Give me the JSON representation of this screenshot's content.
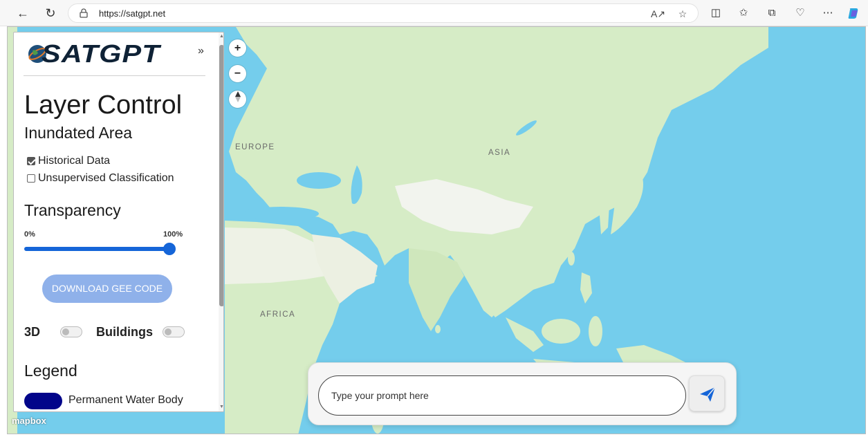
{
  "browser": {
    "url": "https://satgpt.net",
    "icons": [
      "back-icon",
      "refresh-icon",
      "lock-icon",
      "read-aloud-icon",
      "favorite-icon",
      "split-screen-icon",
      "favorites-bar-icon",
      "collections-icon",
      "browser-essentials-icon",
      "more-icon",
      "copilot-icon"
    ]
  },
  "panel": {
    "logo_text": "SATGPT",
    "collapse_label": "»",
    "title": "Layer Control",
    "section_inundated": "Inundated Area",
    "checkboxes": [
      {
        "label": "Historical Data",
        "checked": true
      },
      {
        "label": "Unsupervised Classification",
        "checked": false
      }
    ],
    "transparency_title": "Transparency",
    "slider_min_label": "0%",
    "slider_max_label": "100%",
    "slider_value": 1.0,
    "download_button": "DOWNLOAD GEE CODE",
    "toggle_3d_label": "3D",
    "toggle_3d_on": false,
    "toggle_buildings_label": "Buildings",
    "toggle_buildings_on": false,
    "legend_title": "Legend",
    "legend_items": [
      {
        "label": "Permanent Water Body",
        "color": "#02058a"
      }
    ]
  },
  "map": {
    "labels": [
      "EUROPE",
      "ASIA",
      "AFRICA"
    ],
    "zoom_in": "+",
    "zoom_out": "−",
    "attribution": "mapbox"
  },
  "prompt": {
    "placeholder": "Type your prompt here"
  },
  "colors": {
    "water": "#74cdec",
    "land": "#d9edcb",
    "accent": "#1565d8",
    "download_button": "#8fb1ea"
  }
}
